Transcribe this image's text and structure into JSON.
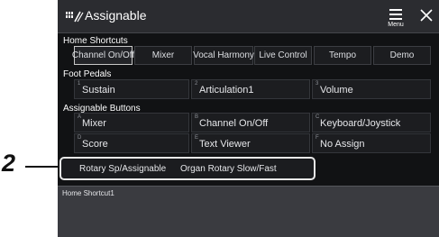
{
  "callout": {
    "number": "2"
  },
  "header": {
    "title": "Assignable",
    "menu_label": "Menu",
    "icon": "assignable-icon",
    "close_icon": "close-icon"
  },
  "home_shortcuts": {
    "label": "Home Shortcuts",
    "items": [
      "Channel On/Off",
      "Mixer",
      "Vocal Harmony",
      "Live Control",
      "Tempo",
      "Demo"
    ],
    "selected_index": 0
  },
  "foot_pedals": {
    "label": "Foot Pedals",
    "items": [
      {
        "index": "1",
        "label": "Sustain"
      },
      {
        "index": "2",
        "label": "Articulation1"
      },
      {
        "index": "3",
        "label": "Volume"
      }
    ]
  },
  "assignable_buttons": {
    "label": "Assignable Buttons",
    "items": [
      {
        "index": "A",
        "label": "Mixer"
      },
      {
        "index": "B",
        "label": "Channel On/Off"
      },
      {
        "index": "C",
        "label": "Keyboard/Joystick"
      },
      {
        "index": "D",
        "label": "Score"
      },
      {
        "index": "E",
        "label": "Text Viewer"
      },
      {
        "index": "F",
        "label": "No Assign"
      }
    ]
  },
  "rotary": {
    "left_label": "Rotary Sp/Assignable",
    "right_label": "Organ Rotary Slow/Fast"
  },
  "info_bar": {
    "text": "Home Shortcut1"
  },
  "colors": {
    "background": "#111214",
    "titlebar": "#2b2c30",
    "info_bar": "#3a3b40",
    "highlight": "#e8e8e8"
  }
}
